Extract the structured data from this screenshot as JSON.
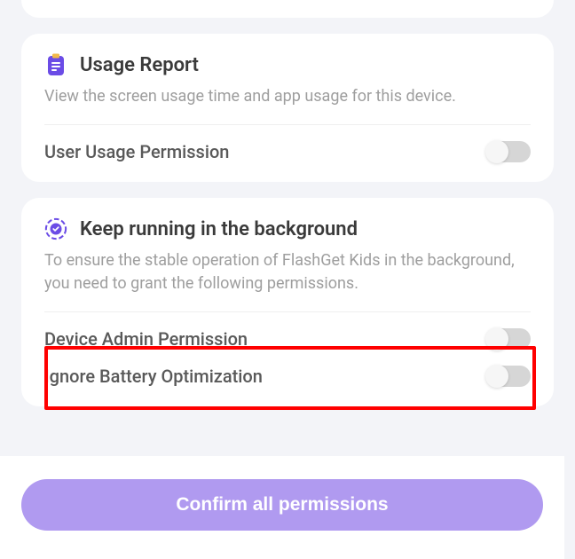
{
  "cards": {
    "usage": {
      "title": "Usage Report",
      "desc": "View the screen usage time and app usage for this device.",
      "permissions": {
        "user_usage": {
          "label": "User Usage Permission",
          "on": false
        }
      }
    },
    "background": {
      "title": "Keep running in the background",
      "desc": "To ensure the stable operation of FlashGet Kids in the background, you need to grant the following permissions.",
      "permissions": {
        "device_admin": {
          "label": "Device Admin Permission",
          "on": false
        },
        "battery_opt": {
          "label": "Ignore Battery Optimization",
          "on": false
        }
      }
    }
  },
  "confirm_label": "Confirm all permissions",
  "colors": {
    "accent": "#b09af0",
    "icon_purple": "#6b4ce6",
    "highlight": "#ff0000"
  }
}
